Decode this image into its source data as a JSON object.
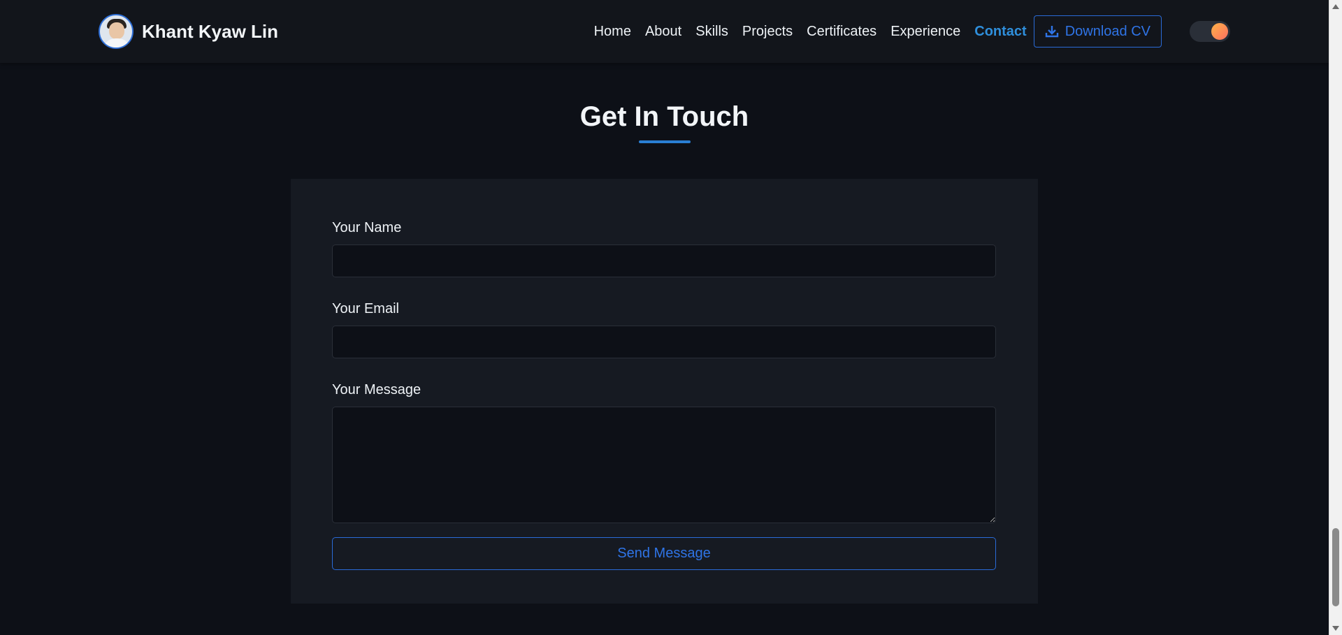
{
  "navbar": {
    "brand_name": "Khant Kyaw Lin",
    "links": [
      {
        "label": "Home",
        "active": false
      },
      {
        "label": "About",
        "active": false
      },
      {
        "label": "Skills",
        "active": false
      },
      {
        "label": "Projects",
        "active": false
      },
      {
        "label": "Certificates",
        "active": false
      },
      {
        "label": "Experience",
        "active": false
      },
      {
        "label": "Contact",
        "active": true
      }
    ],
    "cv_button_label": "Download CV",
    "cv_icon": "download-icon",
    "theme_toggle": "theme-toggle"
  },
  "contact": {
    "title": "Get In Touch",
    "name_label": "Your Name",
    "email_label": "Your Email",
    "message_label": "Your Message",
    "name_value": "",
    "email_value": "",
    "message_value": "",
    "send_label": "Send Message"
  },
  "colors": {
    "background": "#0d1017",
    "navbar": "#12151b",
    "card": "#161a22",
    "accent": "#2f74e6",
    "active_link": "#2f8fdc"
  }
}
